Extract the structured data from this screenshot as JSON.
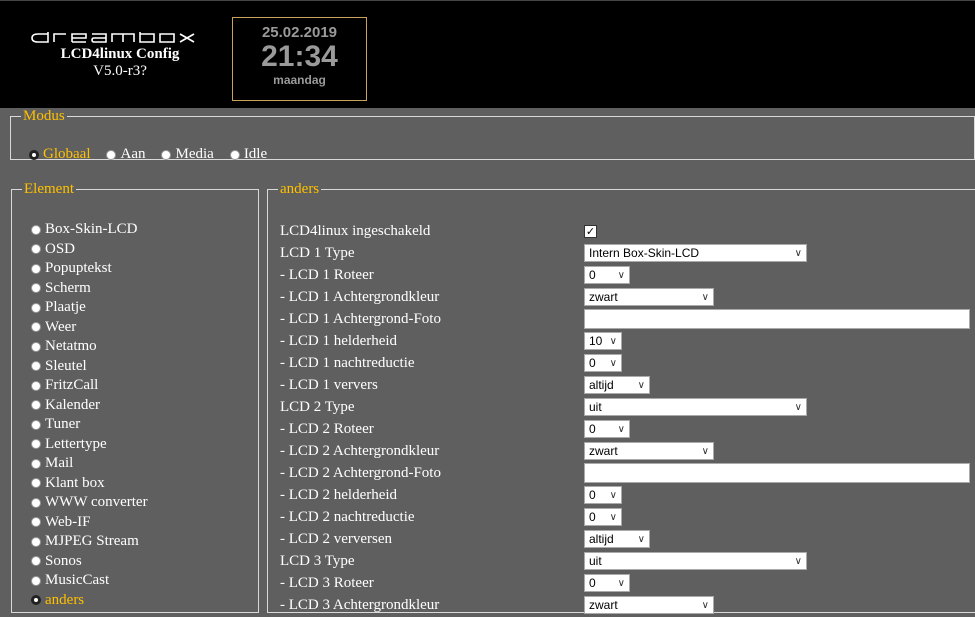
{
  "header": {
    "logo_text": "dreambox",
    "app_title": "LCD4linux Config",
    "version": "V5.0-r3?",
    "clock": {
      "date": "25.02.2019",
      "time": "21:34",
      "day": "maandag"
    }
  },
  "modus": {
    "legend": "Modus",
    "options": [
      "Globaal",
      "Aan",
      "Media",
      "Idle"
    ],
    "selected": "Globaal"
  },
  "element": {
    "legend": "Element",
    "items": [
      "Box-Skin-LCD",
      "OSD",
      "Popuptekst",
      "Scherm",
      "Plaatje",
      "Weer",
      "Netatmo",
      "Sleutel",
      "FritzCall",
      "Kalender",
      "Tuner",
      "Lettertype",
      "Mail",
      "Klant box",
      "WWW converter",
      "Web-IF",
      "MJPEG Stream",
      "Sonos",
      "MusicCast",
      "anders"
    ],
    "selected": "anders"
  },
  "anders": {
    "legend": "anders",
    "rows": [
      {
        "label": "LCD4linux ingeschakeld",
        "type": "checkbox",
        "checked": true
      },
      {
        "label": "LCD 1 Type",
        "type": "select",
        "value": "Intern Box-Skin-LCD",
        "size": "wide"
      },
      {
        "label": "- LCD 1 Roteer",
        "type": "select",
        "value": "0",
        "size": "s"
      },
      {
        "label": "- LCD 1 Achtergrondkleur",
        "type": "select",
        "value": "zwart",
        "size": "m"
      },
      {
        "label": "- LCD 1 Achtergrond-Foto",
        "type": "text",
        "value": ""
      },
      {
        "label": "- LCD 1 helderheid",
        "type": "select",
        "value": "10",
        "size": "xs"
      },
      {
        "label": "- LCD 1 nachtreductie",
        "type": "select",
        "value": "0",
        "size": "xs"
      },
      {
        "label": "- LCD 1 ververs",
        "type": "select",
        "value": "altijd",
        "size": "sm"
      },
      {
        "label": "LCD 2 Type",
        "type": "select",
        "value": "uit",
        "size": "wide"
      },
      {
        "label": "- LCD 2 Roteer",
        "type": "select",
        "value": "0",
        "size": "s"
      },
      {
        "label": "- LCD 2 Achtergrondkleur",
        "type": "select",
        "value": "zwart",
        "size": "m"
      },
      {
        "label": "- LCD 2 Achtergrond-Foto",
        "type": "text",
        "value": ""
      },
      {
        "label": "- LCD 2 helderheid",
        "type": "select",
        "value": "0",
        "size": "xs"
      },
      {
        "label": "- LCD 2 nachtreductie",
        "type": "select",
        "value": "0",
        "size": "xs"
      },
      {
        "label": "- LCD 2 verversen",
        "type": "select",
        "value": "altijd",
        "size": "sm"
      },
      {
        "label": "LCD 3 Type",
        "type": "select",
        "value": "uit",
        "size": "wide"
      },
      {
        "label": "- LCD 3 Roteer",
        "type": "select",
        "value": "0",
        "size": "s"
      },
      {
        "label": "- LCD 3 Achtergrondkleur",
        "type": "select",
        "value": "zwart",
        "size": "m"
      }
    ]
  },
  "colors": {
    "accent": "#ffc000",
    "background": "#5f5f5f",
    "header": "#000000",
    "clock_border": "#c9a25c"
  }
}
